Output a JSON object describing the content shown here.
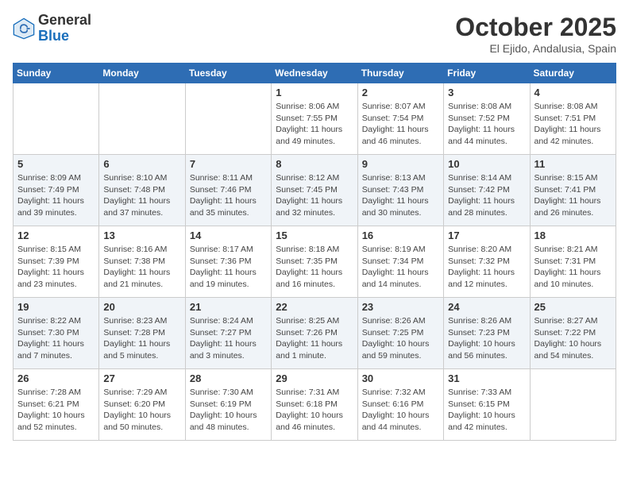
{
  "header": {
    "logo_general": "General",
    "logo_blue": "Blue",
    "month_title": "October 2025",
    "location": "El Ejido, Andalusia, Spain"
  },
  "days_of_week": [
    "Sunday",
    "Monday",
    "Tuesday",
    "Wednesday",
    "Thursday",
    "Friday",
    "Saturday"
  ],
  "weeks": [
    [
      {
        "day": "",
        "info": ""
      },
      {
        "day": "",
        "info": ""
      },
      {
        "day": "",
        "info": ""
      },
      {
        "day": "1",
        "info": "Sunrise: 8:06 AM\nSunset: 7:55 PM\nDaylight: 11 hours and 49 minutes."
      },
      {
        "day": "2",
        "info": "Sunrise: 8:07 AM\nSunset: 7:54 PM\nDaylight: 11 hours and 46 minutes."
      },
      {
        "day": "3",
        "info": "Sunrise: 8:08 AM\nSunset: 7:52 PM\nDaylight: 11 hours and 44 minutes."
      },
      {
        "day": "4",
        "info": "Sunrise: 8:08 AM\nSunset: 7:51 PM\nDaylight: 11 hours and 42 minutes."
      }
    ],
    [
      {
        "day": "5",
        "info": "Sunrise: 8:09 AM\nSunset: 7:49 PM\nDaylight: 11 hours and 39 minutes."
      },
      {
        "day": "6",
        "info": "Sunrise: 8:10 AM\nSunset: 7:48 PM\nDaylight: 11 hours and 37 minutes."
      },
      {
        "day": "7",
        "info": "Sunrise: 8:11 AM\nSunset: 7:46 PM\nDaylight: 11 hours and 35 minutes."
      },
      {
        "day": "8",
        "info": "Sunrise: 8:12 AM\nSunset: 7:45 PM\nDaylight: 11 hours and 32 minutes."
      },
      {
        "day": "9",
        "info": "Sunrise: 8:13 AM\nSunset: 7:43 PM\nDaylight: 11 hours and 30 minutes."
      },
      {
        "day": "10",
        "info": "Sunrise: 8:14 AM\nSunset: 7:42 PM\nDaylight: 11 hours and 28 minutes."
      },
      {
        "day": "11",
        "info": "Sunrise: 8:15 AM\nSunset: 7:41 PM\nDaylight: 11 hours and 26 minutes."
      }
    ],
    [
      {
        "day": "12",
        "info": "Sunrise: 8:15 AM\nSunset: 7:39 PM\nDaylight: 11 hours and 23 minutes."
      },
      {
        "day": "13",
        "info": "Sunrise: 8:16 AM\nSunset: 7:38 PM\nDaylight: 11 hours and 21 minutes."
      },
      {
        "day": "14",
        "info": "Sunrise: 8:17 AM\nSunset: 7:36 PM\nDaylight: 11 hours and 19 minutes."
      },
      {
        "day": "15",
        "info": "Sunrise: 8:18 AM\nSunset: 7:35 PM\nDaylight: 11 hours and 16 minutes."
      },
      {
        "day": "16",
        "info": "Sunrise: 8:19 AM\nSunset: 7:34 PM\nDaylight: 11 hours and 14 minutes."
      },
      {
        "day": "17",
        "info": "Sunrise: 8:20 AM\nSunset: 7:32 PM\nDaylight: 11 hours and 12 minutes."
      },
      {
        "day": "18",
        "info": "Sunrise: 8:21 AM\nSunset: 7:31 PM\nDaylight: 11 hours and 10 minutes."
      }
    ],
    [
      {
        "day": "19",
        "info": "Sunrise: 8:22 AM\nSunset: 7:30 PM\nDaylight: 11 hours and 7 minutes."
      },
      {
        "day": "20",
        "info": "Sunrise: 8:23 AM\nSunset: 7:28 PM\nDaylight: 11 hours and 5 minutes."
      },
      {
        "day": "21",
        "info": "Sunrise: 8:24 AM\nSunset: 7:27 PM\nDaylight: 11 hours and 3 minutes."
      },
      {
        "day": "22",
        "info": "Sunrise: 8:25 AM\nSunset: 7:26 PM\nDaylight: 11 hours and 1 minute."
      },
      {
        "day": "23",
        "info": "Sunrise: 8:26 AM\nSunset: 7:25 PM\nDaylight: 10 hours and 59 minutes."
      },
      {
        "day": "24",
        "info": "Sunrise: 8:26 AM\nSunset: 7:23 PM\nDaylight: 10 hours and 56 minutes."
      },
      {
        "day": "25",
        "info": "Sunrise: 8:27 AM\nSunset: 7:22 PM\nDaylight: 10 hours and 54 minutes."
      }
    ],
    [
      {
        "day": "26",
        "info": "Sunrise: 7:28 AM\nSunset: 6:21 PM\nDaylight: 10 hours and 52 minutes."
      },
      {
        "day": "27",
        "info": "Sunrise: 7:29 AM\nSunset: 6:20 PM\nDaylight: 10 hours and 50 minutes."
      },
      {
        "day": "28",
        "info": "Sunrise: 7:30 AM\nSunset: 6:19 PM\nDaylight: 10 hours and 48 minutes."
      },
      {
        "day": "29",
        "info": "Sunrise: 7:31 AM\nSunset: 6:18 PM\nDaylight: 10 hours and 46 minutes."
      },
      {
        "day": "30",
        "info": "Sunrise: 7:32 AM\nSunset: 6:16 PM\nDaylight: 10 hours and 44 minutes."
      },
      {
        "day": "31",
        "info": "Sunrise: 7:33 AM\nSunset: 6:15 PM\nDaylight: 10 hours and 42 minutes."
      },
      {
        "day": "",
        "info": ""
      }
    ]
  ]
}
